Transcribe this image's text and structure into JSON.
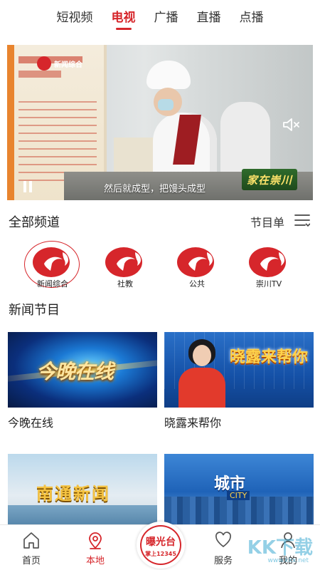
{
  "top_tabs": [
    {
      "label": "短视频",
      "active": false
    },
    {
      "label": "电视",
      "active": true
    },
    {
      "label": "广播",
      "active": false
    },
    {
      "label": "直播",
      "active": false
    },
    {
      "label": "点播",
      "active": false
    }
  ],
  "video": {
    "caption": "然后就成型，把馒头成型",
    "badge": "家在崇川",
    "poster_logo": "新闻综合"
  },
  "channels_section": {
    "title": "全部频道",
    "schedule_label": "节目单",
    "channels": [
      {
        "label": "新闻综合",
        "active": true
      },
      {
        "label": "社教",
        "active": false
      },
      {
        "label": "公共",
        "active": false
      },
      {
        "label": "崇川TV",
        "active": false
      }
    ]
  },
  "news_section": {
    "title": "新闻节目",
    "programs": [
      {
        "label": "今晚在线",
        "thumb_text": "今晚在线"
      },
      {
        "label": "晓露来帮你",
        "thumb_text": "晓露来帮你"
      },
      {
        "label": "",
        "thumb_text": "南通新闻"
      },
      {
        "label": "",
        "thumb_text": "城市",
        "thumb_sub": "CITY"
      }
    ]
  },
  "bottom_nav": {
    "items": [
      {
        "label": "首页",
        "icon": "home-icon",
        "active": false
      },
      {
        "label": "本地",
        "icon": "location-pin-icon",
        "active": true
      },
      {
        "label": "服务",
        "icon": "heart-icon",
        "active": false
      },
      {
        "label": "我的",
        "icon": "profile-icon",
        "active": false
      }
    ],
    "center": {
      "main": "曝光台",
      "sub": "掌上12345"
    }
  },
  "watermark": {
    "text": "KK下载",
    "url": "www.kkx.net"
  },
  "colors": {
    "accent": "#d6262b"
  }
}
